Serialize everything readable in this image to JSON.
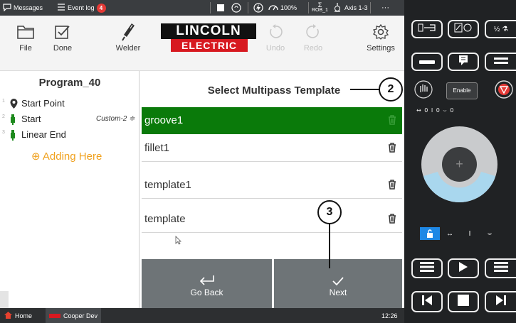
{
  "statusbar": {
    "messages_label": "Messages",
    "eventlog_label": "Event log",
    "eventlog_count": "4",
    "power_label": "100%",
    "robot_label": "ROB_1",
    "axis_label": "Axis 1-3",
    "more_label": "···"
  },
  "toolbar": {
    "file_label": "File",
    "done_label": "Done",
    "welder_label": "Welder",
    "logo_line1": "LINCOLN",
    "logo_line2": "ELECTRIC",
    "undo_label": "Undo",
    "redo_label": "Redo",
    "settings_label": "Settings"
  },
  "program": {
    "title": "Program_40",
    "lines": [
      {
        "num": "1",
        "label": "Start Point",
        "icon": "location-pin-icon"
      },
      {
        "num": "2",
        "label": "Start",
        "icon": "torch-icon",
        "extra": "Custom-2 ≑"
      },
      {
        "num": "3",
        "label": "Linear End",
        "icon": "torch-icon"
      }
    ],
    "adding_label": "⊕ Adding Here"
  },
  "template_dialog": {
    "title": "Select Multipass Template",
    "templates": [
      {
        "name": "groove1",
        "selected": true
      },
      {
        "name": "fillet1",
        "selected": false
      },
      {
        "name": "template1",
        "selected": false
      },
      {
        "name": "template",
        "selected": false
      }
    ],
    "back_label": "Go Back",
    "next_label": "Next"
  },
  "callouts": {
    "two": "2",
    "three": "3"
  },
  "taskbar": {
    "home_label": "Home",
    "app_label": "Cooper Dev",
    "time": "12:26"
  },
  "pendant": {
    "enable_label": "Enable",
    "axis_readout": "↔ 0  I  0  ⌣  0"
  },
  "colors": {
    "selected_row": "#0a7a0a",
    "accent_orange": "#f0a11e",
    "brand_red": "#d71920",
    "button_gray": "#6e7477"
  }
}
